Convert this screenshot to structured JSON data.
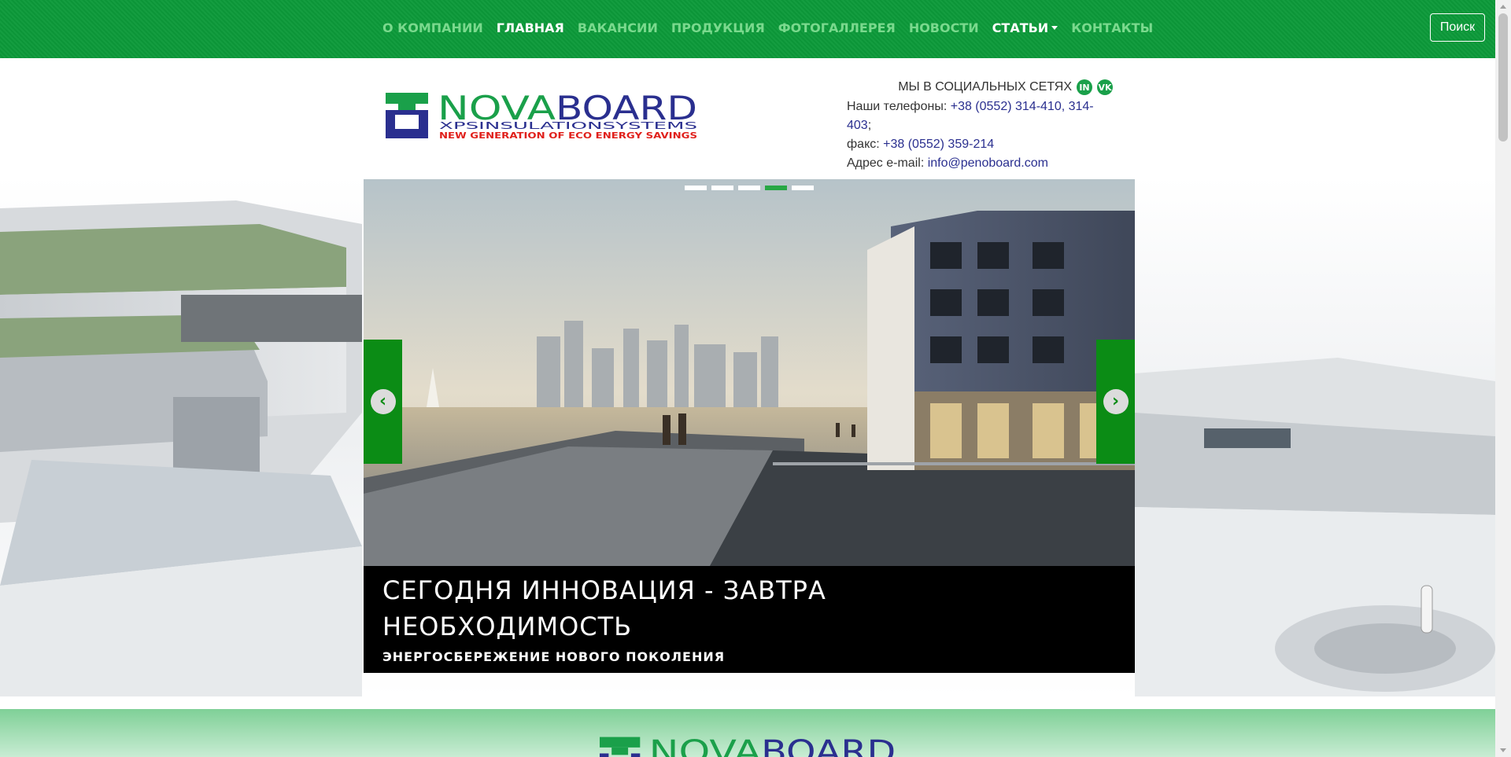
{
  "nav": {
    "items": [
      {
        "label": "О КОМПАНИИ",
        "active": false
      },
      {
        "label": "ГЛАВНАЯ",
        "active": true
      },
      {
        "label": "ВАКАНСИИ",
        "active": false
      },
      {
        "label": "ПРОДУКЦИЯ",
        "active": false
      },
      {
        "label": "ФОТОГАЛЛЕРЕЯ",
        "active": false
      },
      {
        "label": "НОВОСТИ",
        "active": false
      },
      {
        "label": "СТАТЬИ",
        "active": true,
        "dropdown": true
      },
      {
        "label": "КОНТАКТЫ",
        "active": false
      }
    ],
    "search_label": "Поиск"
  },
  "logo": {
    "brand_a": "NOVA",
    "brand_b": "BOARD",
    "tagline": "XPSINSULATIONSYSTEMS",
    "slogan": "NEW GENERATION OF ECO ENERGY SAVINGS"
  },
  "contacts": {
    "social_label": "МЫ В СОЦИАЛЬНЫХ СЕТЯХ",
    "social_icons": [
      "linkedin-icon",
      "vk-icon"
    ],
    "phones_label": "Наши телефоны:",
    "phones_value": "+38 (0552) 314-410, 314-403",
    "phones_suffix": ";",
    "fax_label": "факс:",
    "fax_value": "+38 (0552) 359-214",
    "email_label": "Адрес e-mail:",
    "email_value": "info@penoboard.com"
  },
  "carousel": {
    "slide_count": 5,
    "active_index": 3,
    "prev_icon": "chevron-left-icon",
    "next_icon": "chevron-right-icon",
    "caption_title": "Сегодня инновация - завтра необходимость",
    "caption_subtitle": "Энергосбережение нового поколения"
  },
  "colors": {
    "nav_bg": "#0c9a3a",
    "nav_inactive": "#7ad98d",
    "brand_green": "#1aa04a",
    "brand_navy": "#2a2f8f",
    "slogan_red": "#e0201b",
    "carousel_control": "#0b8c15"
  }
}
